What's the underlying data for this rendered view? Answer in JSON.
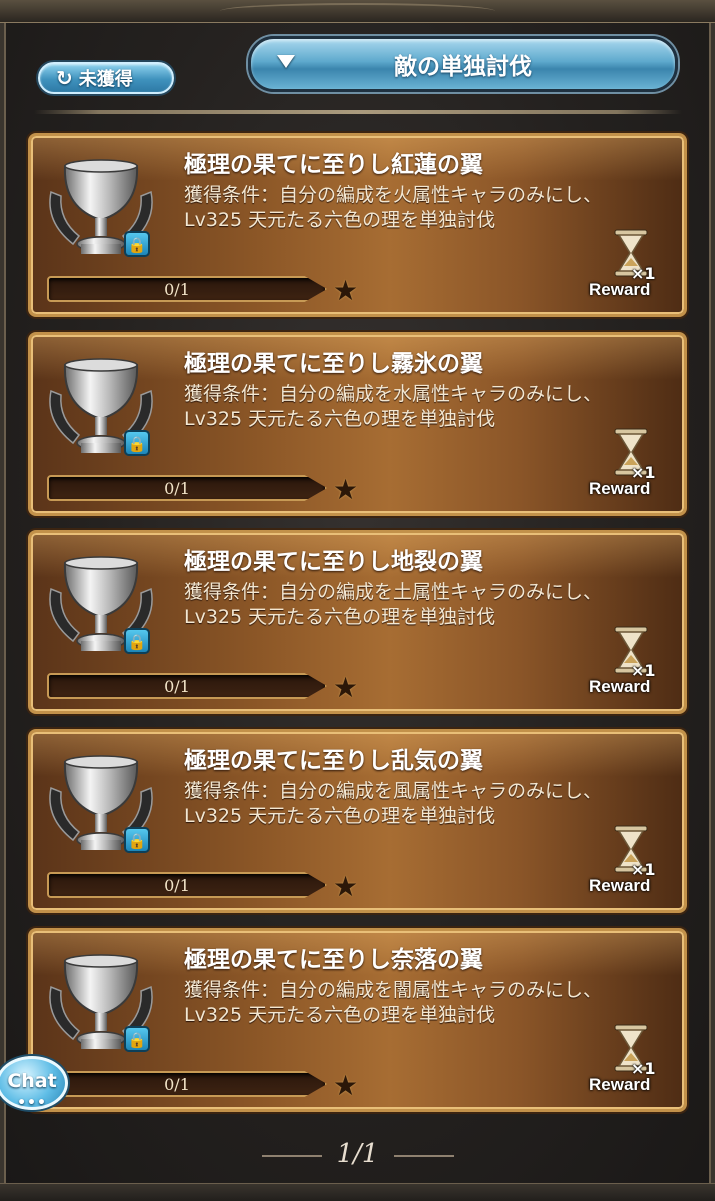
{
  "filter": {
    "label": "未獲得"
  },
  "category": {
    "label": "敵の単独討伐"
  },
  "cards": [
    {
      "title": "極理の果てに至りし紅蓮の翼",
      "desc1": "獲得条件：自分の編成を火属性キャラのみにし、",
      "desc2": "Lv325 天元たる六色の理を単独討伐",
      "progress_text": "0/1",
      "progress": 0,
      "reward_count": "×1",
      "reward_label": "Reward"
    },
    {
      "title": "極理の果てに至りし霧氷の翼",
      "desc1": "獲得条件：自分の編成を水属性キャラのみにし、",
      "desc2": "Lv325 天元たる六色の理を単独討伐",
      "progress_text": "0/1",
      "progress": 0,
      "reward_count": "×1",
      "reward_label": "Reward"
    },
    {
      "title": "極理の果てに至りし地裂の翼",
      "desc1": "獲得条件：自分の編成を土属性キャラのみにし、",
      "desc2": "Lv325 天元たる六色の理を単独討伐",
      "progress_text": "0/1",
      "progress": 0,
      "reward_count": "×1",
      "reward_label": "Reward"
    },
    {
      "title": "極理の果てに至りし乱気の翼",
      "desc1": "獲得条件：自分の編成を風属性キャラのみにし、",
      "desc2": "Lv325 天元たる六色の理を単独討伐",
      "progress_text": "0/1",
      "progress": 0,
      "reward_count": "×1",
      "reward_label": "Reward"
    },
    {
      "title": "極理の果てに至りし奈落の翼",
      "desc1": "獲得条件：自分の編成を闇属性キャラのみにし、",
      "desc2": "Lv325 天元たる六色の理を単独討伐",
      "progress_text": "0/1",
      "progress": 0,
      "reward_count": "×1",
      "reward_label": "Reward"
    }
  ],
  "pager": {
    "text": "1/1"
  },
  "chat": {
    "label": "Chat",
    "dots": "•••"
  },
  "colors": {
    "accent_blue": "#4fa3cc",
    "card_border": "#c2914a",
    "lock_blue": "#1d86b8"
  },
  "icons": {
    "filter": "refresh-icon",
    "dropdown": "triangle-down-icon",
    "trophy": "silver-trophy-icon",
    "lock": "lock-icon",
    "reward": "hourglass-icon",
    "star": "star-icon"
  }
}
